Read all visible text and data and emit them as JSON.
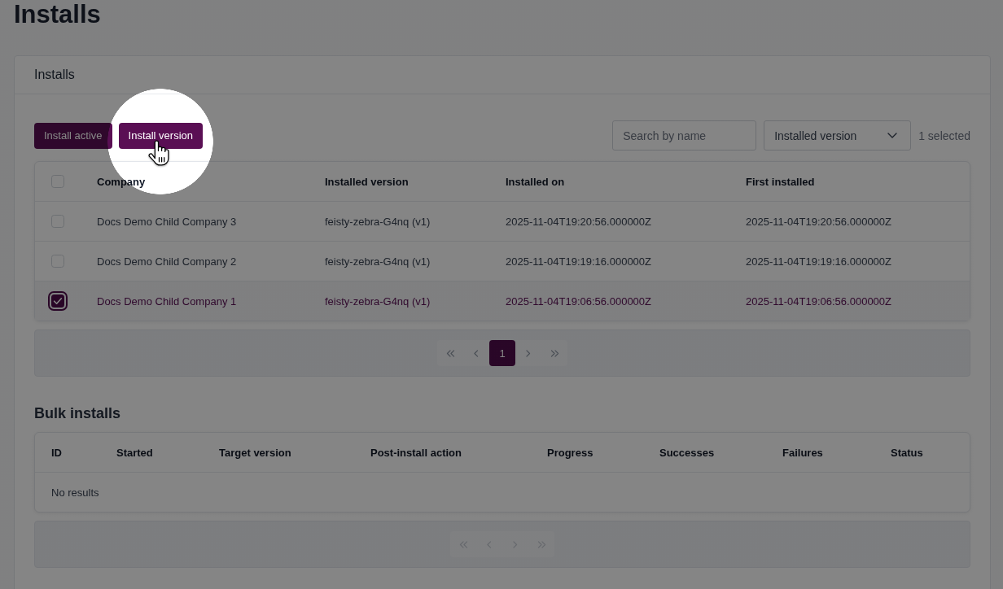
{
  "page_title": "Installs",
  "installs_panel": {
    "title": "Installs",
    "actions": [
      {
        "label": "Install active",
        "highlighted": false
      },
      {
        "label": "Install version",
        "highlighted": true
      }
    ],
    "search": {
      "placeholder": "Search by name"
    },
    "filter": {
      "value": "Installed version"
    },
    "selection_count": "1 selected",
    "table": {
      "select_all": {
        "checked": false
      },
      "columns": [
        "Company",
        "Installed version",
        "Installed on",
        "First installed"
      ],
      "rows": [
        {
          "selected": false,
          "cells": [
            "Docs Demo Child Company 3",
            "feisty-zebra-G4nq (v1)",
            "2025-11-04T19:20:56.000000Z",
            "2025-11-04T19:20:56.000000Z"
          ]
        },
        {
          "selected": false,
          "cells": [
            "Docs Demo Child Company 2",
            "feisty-zebra-G4nq (v1)",
            "2025-11-04T19:19:16.000000Z",
            "2025-11-04T19:19:16.000000Z"
          ]
        },
        {
          "selected": true,
          "cells": [
            "Docs Demo Child Company 1",
            "feisty-zebra-G4nq (v1)",
            "2025-11-04T19:06:56.000000Z",
            "2025-11-04T19:06:56.000000Z"
          ]
        }
      ]
    },
    "pager": {
      "disabled": false,
      "pages": [
        {
          "label": "1",
          "selected": true
        }
      ]
    }
  },
  "bulk_installs": {
    "title": "Bulk installs",
    "table": {
      "columns": [
        "ID",
        "Started",
        "Target version",
        "Post-install action",
        "Progress",
        "Successes",
        "Failures",
        "Status"
      ],
      "empty_message": "No results"
    },
    "pager": {
      "disabled": true
    }
  }
}
